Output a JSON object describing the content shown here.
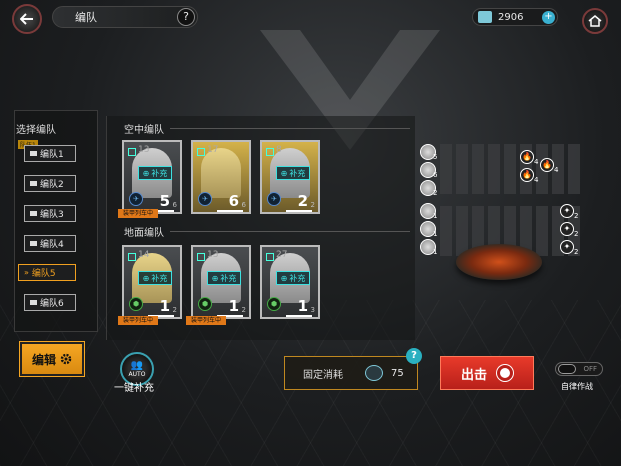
{
  "header": {
    "title": "编队",
    "help_label": "?",
    "currency_value": "2906",
    "currency_plus": "+"
  },
  "team_select": {
    "title": "选择编队",
    "badge": "队伍1",
    "teams": [
      {
        "label": "编队1"
      },
      {
        "label": "编队2"
      },
      {
        "label": "编队3"
      },
      {
        "label": "编队4"
      },
      {
        "label": "编队5"
      },
      {
        "label": "编队6"
      }
    ],
    "active_marker": "»",
    "edit_label": "编辑"
  },
  "air_team": {
    "label": "空中编队",
    "cards": [
      {
        "level": "13",
        "refill": "补充",
        "count": "5",
        "countsub": "6",
        "tag": "装甲列车中"
      },
      {
        "level": "17",
        "refill": "补充",
        "count": "6",
        "countsub": "6",
        "tag": ""
      },
      {
        "level": "8",
        "refill": "补充",
        "count": "2",
        "countsub": "2",
        "tag": ""
      }
    ]
  },
  "ground_team": {
    "label": "地面编队",
    "cards": [
      {
        "level": "14",
        "refill": "补充",
        "count": "1",
        "countsub": "2",
        "tag": "装甲列车中"
      },
      {
        "level": "13",
        "refill": "补充",
        "count": "1",
        "countsub": "2",
        "tag": "装甲列车中"
      },
      {
        "level": "27",
        "refill": "补充",
        "count": "1",
        "countsub": "3",
        "tag": ""
      }
    ]
  },
  "formation": {
    "air_units": [
      "5",
      "6",
      "2"
    ],
    "ground_units": [
      "1",
      "1",
      "1"
    ],
    "air_enemies": [
      "4",
      "4",
      "4"
    ],
    "ground_enemies": [
      "2",
      "2",
      "2"
    ]
  },
  "bottom": {
    "auto_label": "一键补充",
    "auto_icon": "AUTO",
    "cost_label": "固定消耗",
    "cost_value": "75",
    "cost_help": "?",
    "sortie_label": "出击",
    "toggle_state": "OFF",
    "auto_combat_label": "自律作战"
  }
}
